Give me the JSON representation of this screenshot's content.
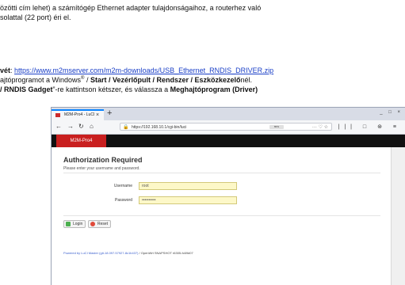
{
  "document": {
    "line1": "özötti cím lehet) a számítógép Ethernet adapter tulajdonságaihoz, a routerhez való",
    "line2": "solattal (22 port) éri el.",
    "line3_prefix": "vét",
    "line3_colon": ": ",
    "link_url": "https://www.m2mserver.com/m2m-downloads/USB_Ethernet_RNDIS_DRIVER.zip",
    "line4_a": "ajtóprogramot a Windows",
    "line4_reg": "®",
    "line4_b": " / ",
    "line4_path": "Start / Vezérlőpult / Rendszer / Eszközkezelő",
    "line4_c": "nél.",
    "line5_a": "/ RNDIS Gadget",
    "line5_b": "”-re kattintson kétszer, és válassza a ",
    "line5_c": "Meghajtóprogram (Driver)"
  },
  "browser": {
    "tab_title": "M2M-Pro4 - LuCI",
    "tab_close": "×",
    "new_tab": "+",
    "window_controls": "_ □ ×",
    "url": "https://192.168.10.1/cgi-bin/luci",
    "url_badge": "80%",
    "url_more": "··· ♡ ☆",
    "toolbar_icons": "||| □ ⊛ ≡"
  },
  "luci": {
    "brand": "M2M-Pro4",
    "title": "Authorization Required",
    "subtitle": "Please enter your username and password.",
    "username_label": "Username",
    "username_value": "root",
    "password_label": "Password",
    "password_value": "••••••••••",
    "login_label": "Login",
    "reset_label": "Reset",
    "footer_link": "Powered by LuCI Master (git-18.097.57927-8c1b437)",
    "footer_rest": " / OpenWrt SNAPSHOT r6305-fc69d07"
  },
  "colors": {
    "brand_red": "#c91f1f",
    "link_blue": "#1a3fc7",
    "field_yellow": "#fdf8c8"
  }
}
